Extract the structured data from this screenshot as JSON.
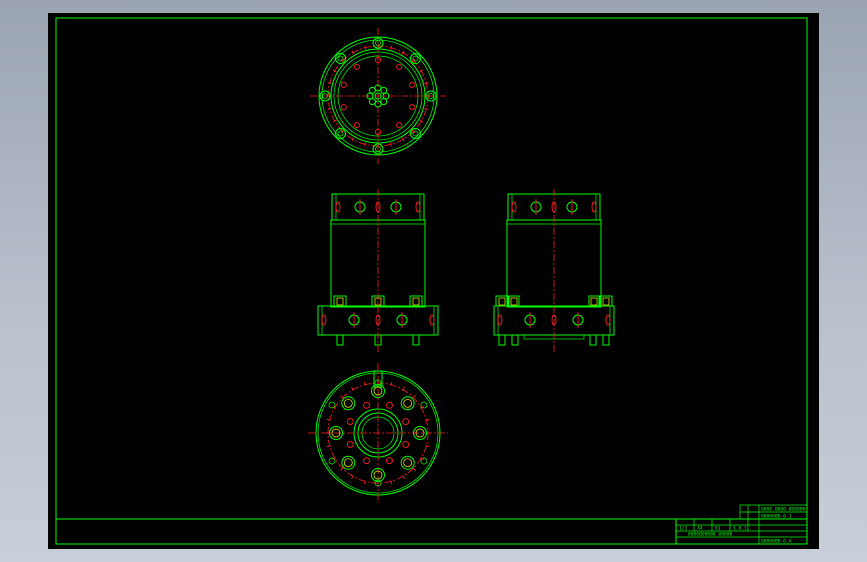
{
  "viewport": {
    "background": "gradient-gray",
    "sheet_color": "#000000",
    "line_color": "#00ff00",
    "center_line_color": "#ff2020",
    "hidden_hole_color": "#ffff00"
  },
  "drawing": {
    "views": [
      {
        "id": "top-view",
        "kind": "circular-flange-plan"
      },
      {
        "id": "front-view",
        "kind": "cylindrical-body-elevation"
      },
      {
        "id": "side-view",
        "kind": "cylindrical-body-elevation"
      },
      {
        "id": "bottom-view",
        "kind": "circular-base-plan"
      }
    ]
  },
  "title_block": {
    "drawing_no_top": "0000000-0-1",
    "drawing_no_bottom": "0000000-0-A",
    "name_line": "0000-0000-000000",
    "row_labels": [
      "1/1",
      "A4",
      "01",
      "1.0.1"
    ],
    "footer_label": "0000000000 00000"
  }
}
